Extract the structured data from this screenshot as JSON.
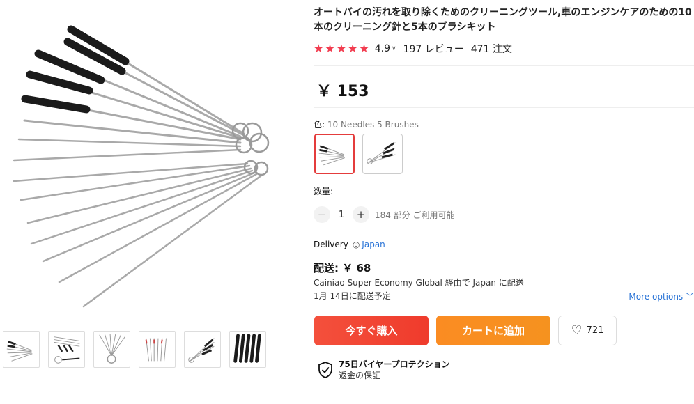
{
  "product": {
    "title": "オートバイの汚れを取り除くためのクリーニングツール,車のエンジンケアのための10本のクリーニング針と5本のブラシキット",
    "rating": "4.9",
    "reviews": "197 レビュー",
    "orders": "471 注文",
    "price": "￥ 153"
  },
  "icons": {
    "star": "star-icon",
    "chevron": "chevron-down-icon",
    "location": "location-pin-icon",
    "heart": "heart-icon",
    "shield": "shield-check-icon"
  },
  "variants": {
    "label": "色:",
    "selected_value": "10 Needles 5 Brushes"
  },
  "quantity": {
    "label": "数量:",
    "minus": "−",
    "plus": "+",
    "value": "1",
    "available": "184 部分 ご利用可能"
  },
  "delivery": {
    "label": "Delivery",
    "country": "Japan",
    "shipping_price": "配送: ￥ 68",
    "method": "Cainiao Super Economy Global 経由で Japan に配送",
    "eta": "1月 14日に配送予定",
    "more_options": "More options ﹀"
  },
  "actions": {
    "buy_now": "今すぐ購入",
    "add_to_cart": "カートに追加",
    "wishlist_count": "721"
  },
  "protection": {
    "title": "75日バイヤープロテクション",
    "subtitle": "返金の保証"
  },
  "colors": {
    "star": "#f23d50",
    "buy": "#ef3b2c",
    "cart": "#f5921f",
    "link": "#2772d6",
    "selected_border": "#e43c3c"
  }
}
